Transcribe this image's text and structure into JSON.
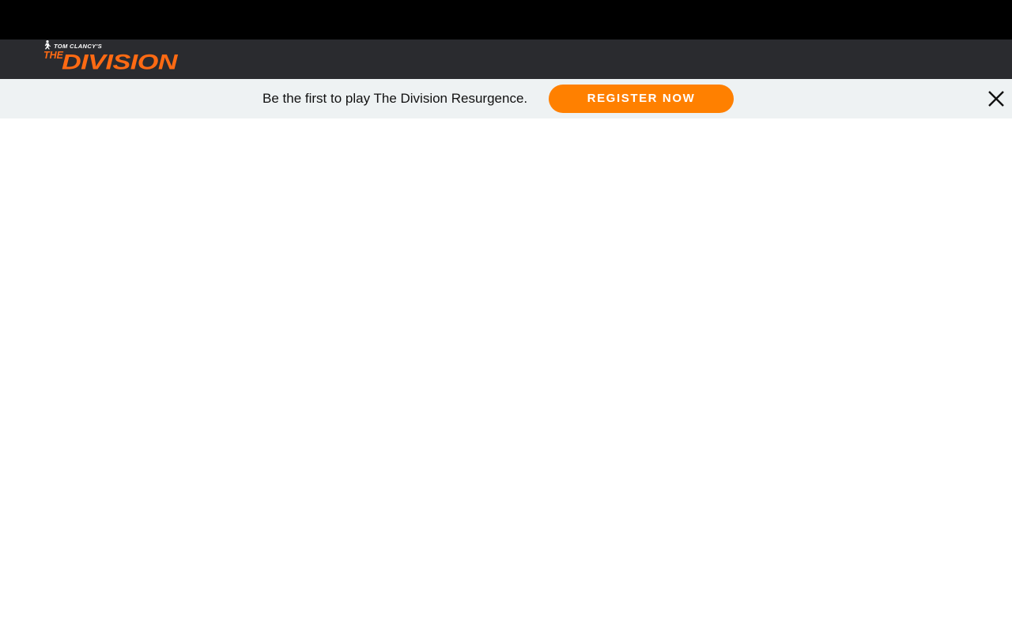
{
  "top_bar": {
    "background": "#000000"
  },
  "header": {
    "background": "#2a2b2f",
    "logo": {
      "small_text": "TOM CLANCY'S",
      "main_text_prefix": "THE",
      "main_text": "DIVISION",
      "color_accent": "#ff6a13",
      "color_small": "#ffffff",
      "icon": "agent-figure-icon"
    }
  },
  "promo_banner": {
    "background": "#eef2f3",
    "text": "Be the first to play The Division Resurgence.",
    "button_label": "REGISTER NOW",
    "button_color": "#ff8000",
    "close_icon": "close-icon"
  }
}
